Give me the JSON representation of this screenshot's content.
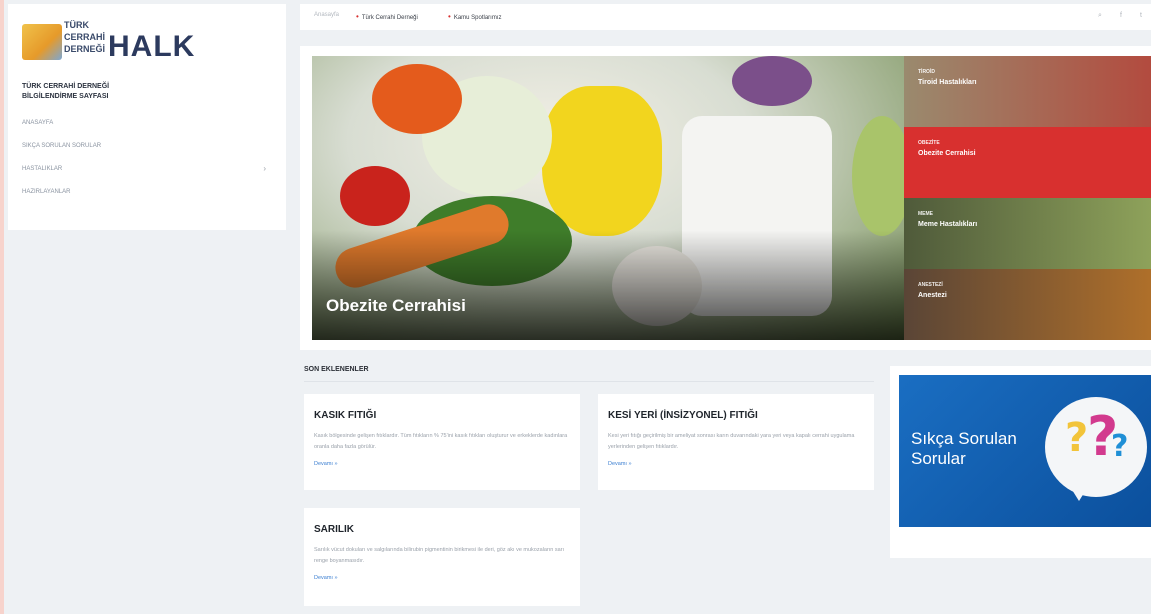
{
  "colors": {
    "accent_red": "#d8302f",
    "faq_blue": "#1a6ec2",
    "link_blue": "#3c7fd1",
    "page_bg": "#eef1f4"
  },
  "brand": {
    "logo_small_lines": [
      "TÜRK",
      "CERRAHİ",
      "DERNEĞİ"
    ],
    "logo_big": "HALK",
    "subtitle_line1": "TÜRK CERRAHİ DERNEĞİ",
    "subtitle_line2": "BİLGİLENDİRME SAYFASI"
  },
  "sidebar": {
    "items": [
      {
        "label": "ANASAYFA"
      },
      {
        "label": "SIKÇA SORULAN SORULAR"
      },
      {
        "label": "HASTALIKLAR",
        "has_children": true
      },
      {
        "label": "HAZIRLAYANLAR"
      }
    ]
  },
  "topbar": {
    "home": "Anasayfa",
    "links": [
      "Türk Cerrahi Derneği",
      "Kamu Spotlarımız"
    ],
    "icons": [
      "search-icon",
      "facebook-icon",
      "twitter-icon"
    ]
  },
  "hero": {
    "title": "Obezite Cerrahisi",
    "side_items": [
      {
        "category": "TİROİD",
        "title": "Tiroid Hastalıkları",
        "color": "#8a7a64"
      },
      {
        "category": "OBEZİTE",
        "title": "Obezite Cerrahisi",
        "color": "#d8302f"
      },
      {
        "category": "MEME",
        "title": "Meme Hastalıkları",
        "color": "#6c7a4f"
      },
      {
        "category": "ANESTEZİ",
        "title": "Anestezi",
        "color": "#6a5442"
      }
    ]
  },
  "recent": {
    "heading": "SON EKLENENLER",
    "more_label": "Devamı »",
    "cards": [
      {
        "title": "KASIK FITIĞI",
        "text": "Kasık bölgesinde gelişen fıtıklardır. Tüm fıtıkların % 75'ini kasık fıtıkları oluşturur ve erkeklerde kadınlara oranla daha fazla görülür."
      },
      {
        "title": "KESİ YERİ (İNSİZYONEL) FITIĞI",
        "text": "Kesi yeri fıtığı geçirilmiş bir ameliyat sonrası karın duvarındaki yara yeri veya kapalı cerrahi uygulama yerlerinden gelişen fıtıklardır."
      },
      {
        "title": "SARILIK",
        "text": "Sarılık vücut dokuları ve salgılarında bilirubin pigmentinin birikmesi ile deri, göz akı ve mukozaların sarı renge boyanmasıdır."
      }
    ]
  },
  "faq_banner": {
    "line1": "Sıkça Sorulan",
    "line2": "Sorular"
  }
}
